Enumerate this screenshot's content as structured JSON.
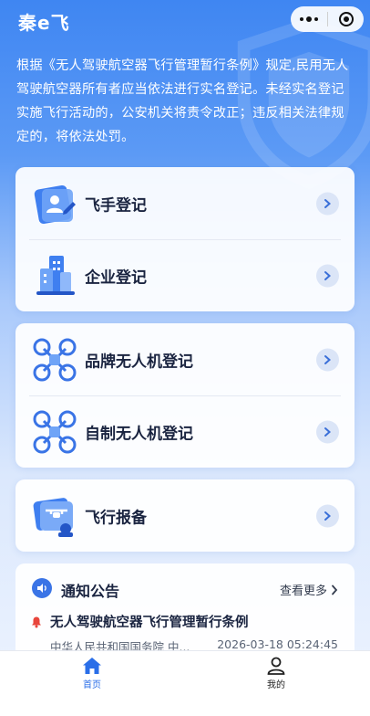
{
  "header": {
    "title": "秦e飞"
  },
  "intro_text": "根据《无人驾驶航空器飞行管理暂行条例》规定,民用无人驾驶航空器所有者应当依法进行实名登记。未经实名登记实施飞行活动的，公安机关将责令改正；违反相关法律规定的，将依法处罚。",
  "cards": {
    "registration": [
      {
        "label": "飞手登记",
        "icon": "pilot-id-card-icon"
      },
      {
        "label": "企业登记",
        "icon": "enterprise-building-icon"
      }
    ],
    "drones": [
      {
        "label": "品牌无人机登记",
        "icon": "drone-icon"
      },
      {
        "label": "自制无人机登记",
        "icon": "drone-icon"
      }
    ],
    "flight": [
      {
        "label": "飞行报备",
        "icon": "flight-report-icon"
      }
    ]
  },
  "notice": {
    "title": "通知公告",
    "more_label": "查看更多",
    "items": [
      {
        "title": "无人驾驶航空器飞行管理暂行条例",
        "source": "中华人民共和国国务院 中...",
        "time": "2026-03-18 05:24:45"
      }
    ]
  },
  "tabbar": {
    "home": "首页",
    "mine": "我的"
  },
  "colors": {
    "accent": "#2a6ee8",
    "gradient_top": "#3f86f2",
    "chevron_bg": "#dbe5f7"
  }
}
